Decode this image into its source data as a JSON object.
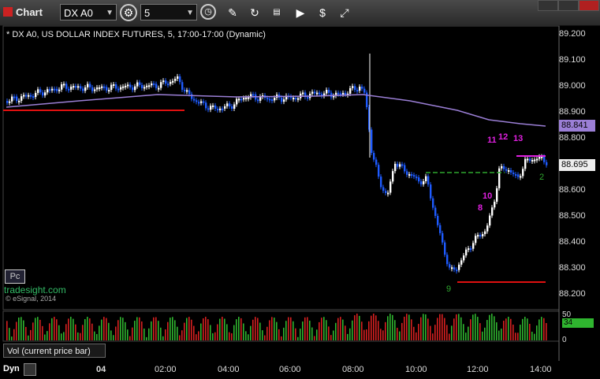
{
  "toolbar": {
    "title": "Chart",
    "symbol": "DX A0",
    "interval": "5"
  },
  "header": {
    "text": "* DX A0, US DOLLAR INDEX FUTURES, 5, 17:00-17:00 (Dynamic)"
  },
  "price_axis": {
    "labels": [
      "89.200",
      "89.100",
      "89.000",
      "88.900",
      "88.800",
      "88.700",
      "88.600",
      "88.500",
      "88.400",
      "88.300",
      "88.200"
    ],
    "badge_ma": "88.841",
    "badge_last": "88.695"
  },
  "annotations": {
    "counts_magenta": [
      "11",
      "12",
      "13",
      "10",
      "8"
    ],
    "count_small_green": "2",
    "count_bottom": "9"
  },
  "side": {
    "pc_label": "Pc",
    "watermark": "tradesight.com",
    "copyright": "© eSignal, 2014"
  },
  "volume": {
    "label": "Vol (current price bar)",
    "axis_top": "50",
    "axis_bottom": "0",
    "badge": "34"
  },
  "time_axis": {
    "labels": [
      "04",
      "02:00",
      "04:00",
      "06:00",
      "08:00",
      "10:00",
      "12:00",
      "14:00"
    ]
  },
  "footer": {
    "dyn_label": "Dyn"
  },
  "colors": {
    "up": "#ffffff",
    "down": "#1e5bff",
    "ma": "#9b7fd6",
    "support": "#e01010",
    "target": "#2fa82f",
    "count": "#e020e0",
    "vol_up": "#2fb52f",
    "vol_down": "#d52020"
  }
}
